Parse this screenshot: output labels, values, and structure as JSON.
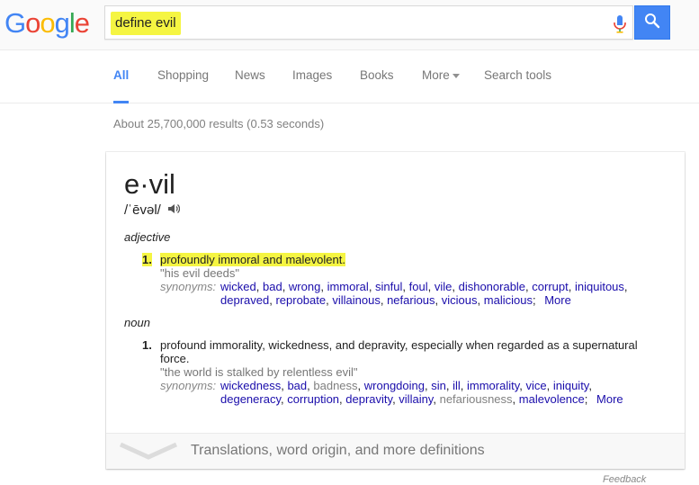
{
  "logo": {
    "letters": [
      "G",
      "o",
      "o",
      "g",
      "l",
      "e"
    ]
  },
  "search": {
    "query": "define evil"
  },
  "icons": {
    "mic": "microphone-icon",
    "search": "magnifier-icon",
    "speaker": "speaker-icon",
    "chevron": "chevron-down-icon"
  },
  "colors": {
    "google_blue": "#4285f4",
    "link": "#1a0dab",
    "highlight": "#f5f542"
  },
  "tabs": [
    {
      "label": "All",
      "active": true
    },
    {
      "label": "Shopping",
      "active": false
    },
    {
      "label": "News",
      "active": false
    },
    {
      "label": "Images",
      "active": false
    },
    {
      "label": "Books",
      "active": false
    },
    {
      "label": "More",
      "active": false
    },
    {
      "label": "Search tools",
      "active": false
    }
  ],
  "results_count": "About 25,700,000 results (0.53 seconds)",
  "definition": {
    "word": "e·vil",
    "phonetic": "/ˈēvəl/",
    "senses": [
      {
        "part_of_speech": "adjective",
        "number": "1.",
        "text": "profoundly immoral and malevolent.",
        "example": "\"his evil deeds\"",
        "synonyms_label": "synonyms:",
        "synonyms_line1": [
          "wicked",
          "bad",
          "wrong",
          "immoral",
          "sinful",
          "foul",
          "vile",
          "dishonorable",
          "corrupt",
          "iniquitous"
        ],
        "synonyms_line2": [
          "depraved",
          "reprobate",
          "villainous",
          "nefarious",
          "vicious",
          "malicious"
        ],
        "more": "More"
      },
      {
        "part_of_speech": "noun",
        "number": "1.",
        "text": "profound immorality, wickedness, and depravity, especially when regarded as a supernatural force.",
        "example": "\"the world is stalked by relentless evil\"",
        "synonyms_label": "synonyms:",
        "synonyms_line1": [
          "wickedness",
          "bad",
          "badness",
          "wrongdoing",
          "sin",
          "ill",
          "immorality",
          "vice",
          "iniquity"
        ],
        "synonyms_line2": [
          "degeneracy",
          "corruption",
          "depravity",
          "villainy",
          "nefariousness",
          "malevolence"
        ],
        "more": "More"
      }
    ],
    "footer_text": "Translations, word origin, and more definitions"
  },
  "feedback": "Feedback"
}
